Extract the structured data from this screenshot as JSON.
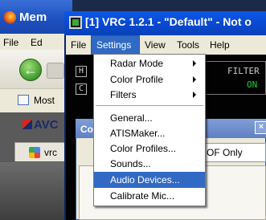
{
  "firefox": {
    "title": "Mem",
    "menu": [
      "File",
      "Ed"
    ],
    "bookmark_label": "Most",
    "site_logo": "AVC",
    "tab_label": "vrc"
  },
  "vrc": {
    "title": "[1] VRC 1.2.1 - \"Default\" - Not o",
    "menu": {
      "file": "File",
      "settings": "Settings",
      "view": "View",
      "tools": "Tools",
      "help": "Help"
    },
    "radar_buttons": [
      "H",
      "C"
    ],
    "filter_label": "FILTER",
    "filter_state": "ON",
    "dialog_title": "Co",
    "dialog_close": "×",
    "dialog_field": "OF Only"
  },
  "settings_menu": {
    "items": [
      {
        "label": "Radar Mode",
        "submenu": true
      },
      {
        "label": "Color Profile",
        "submenu": true
      },
      {
        "label": "Filters",
        "submenu": true
      },
      {
        "label": "General...",
        "submenu": false
      },
      {
        "label": "ATISMaker...",
        "submenu": false
      },
      {
        "label": "Color Profiles...",
        "submenu": false
      },
      {
        "label": "Sounds...",
        "submenu": false
      },
      {
        "label": "Audio Devices...",
        "submenu": false,
        "highlighted": true
      },
      {
        "label": "Calibrate Mic...",
        "submenu": false
      }
    ]
  },
  "colors": {
    "selection": "#316ac5",
    "titlebar": "#0a48cf",
    "filter_on": "#1fd03f"
  }
}
